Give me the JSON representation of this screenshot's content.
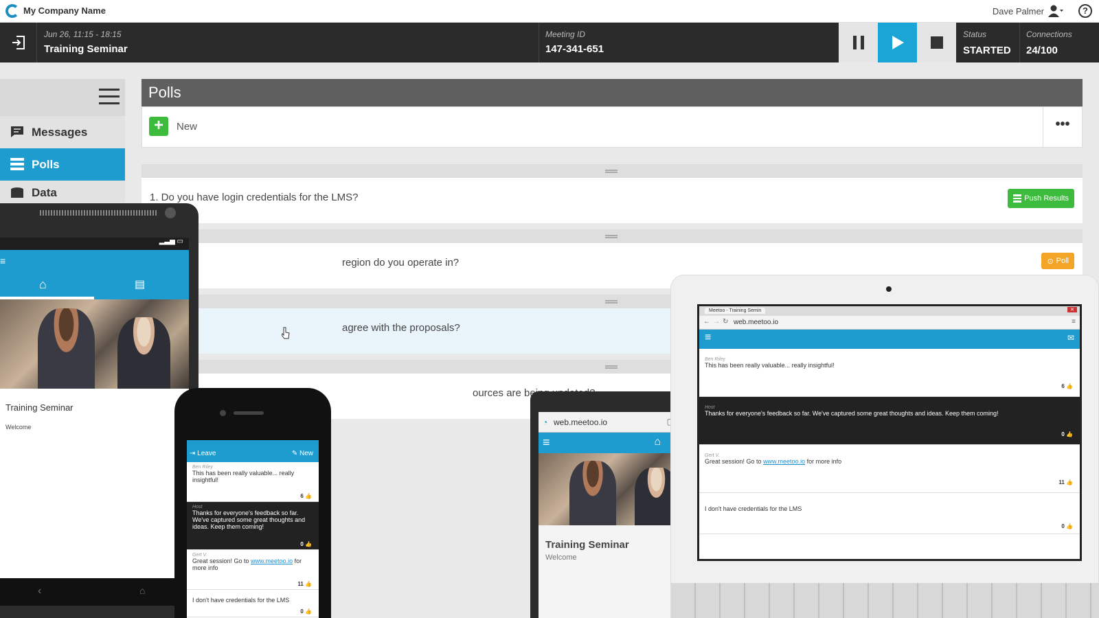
{
  "topbar": {
    "company": "My Company Name",
    "user": "Dave Palmer"
  },
  "meeting": {
    "date": "Jun 26, 11:15 - 18:15",
    "title": "Training Seminar",
    "id_label": "Meeting ID",
    "id_value": "147-341-651",
    "status_label": "Status",
    "status_value": "STARTED",
    "connections_label": "Connections",
    "connections_value": "24/100"
  },
  "sidebar": {
    "items": [
      {
        "label": "Messages",
        "icon": "messages-icon"
      },
      {
        "label": "Polls",
        "icon": "polls-icon"
      },
      {
        "label": "Data",
        "icon": "data-icon"
      }
    ]
  },
  "panel": {
    "title": "Polls",
    "new_label": "New",
    "more_label": "•••"
  },
  "polls": [
    {
      "text": "1.  Do you have login credentials for the LMS?",
      "action": "Push Results"
    },
    {
      "text": "region do you operate in?",
      "action": "Poll"
    },
    {
      "text": "agree with the proposals?",
      "action": ""
    },
    {
      "text": "ources are being updated?",
      "action": ""
    }
  ],
  "android": {
    "event_title": "Training Seminar",
    "welcome": "Welcome"
  },
  "iphone": {
    "leave": "Leave",
    "new": "New",
    "messages": [
      {
        "who": "Ben Riley",
        "text": "This has been really valuable... really insightful!",
        "count": "6"
      },
      {
        "who": "Host",
        "text": "Thanks for everyone's feedback so far. We've captured some great thoughts and ideas. Keep them coming!",
        "count": "0"
      },
      {
        "who": "Gert V.",
        "text_pre": "Great session! Go to ",
        "link": "www.meetoo.io",
        "text_post": " for more info",
        "count": "11"
      },
      {
        "who": "",
        "text": "I don't have credentials for the LMS",
        "count": "0"
      }
    ]
  },
  "tablet": {
    "url": "web.meetoo.io",
    "event_title": "Training Seminar",
    "welcome": "Welcome"
  },
  "laptop": {
    "tab_title": "Meetoo - Training Semin",
    "url": "web.meetoo.io",
    "messages": [
      {
        "who": "Ben Riley",
        "text": "This has been really valuable... really insightful!",
        "count": "6"
      },
      {
        "who": "Host",
        "text": "Thanks for everyone's feedback so far. We've captured some great thoughts and ideas. Keep them coming!",
        "count": "0"
      },
      {
        "who": "Gert V.",
        "text_pre": "Great session! Go to ",
        "link": "www.meetoo.io",
        "text_post": " for more info",
        "count": "11"
      },
      {
        "who": "",
        "text": "I don't have credentials for the LMS",
        "count": "0"
      }
    ]
  },
  "colors": {
    "accent": "#1aa5d6",
    "green": "#3dbb3d",
    "orange": "#f2a526",
    "dark": "#2b2b2b"
  }
}
